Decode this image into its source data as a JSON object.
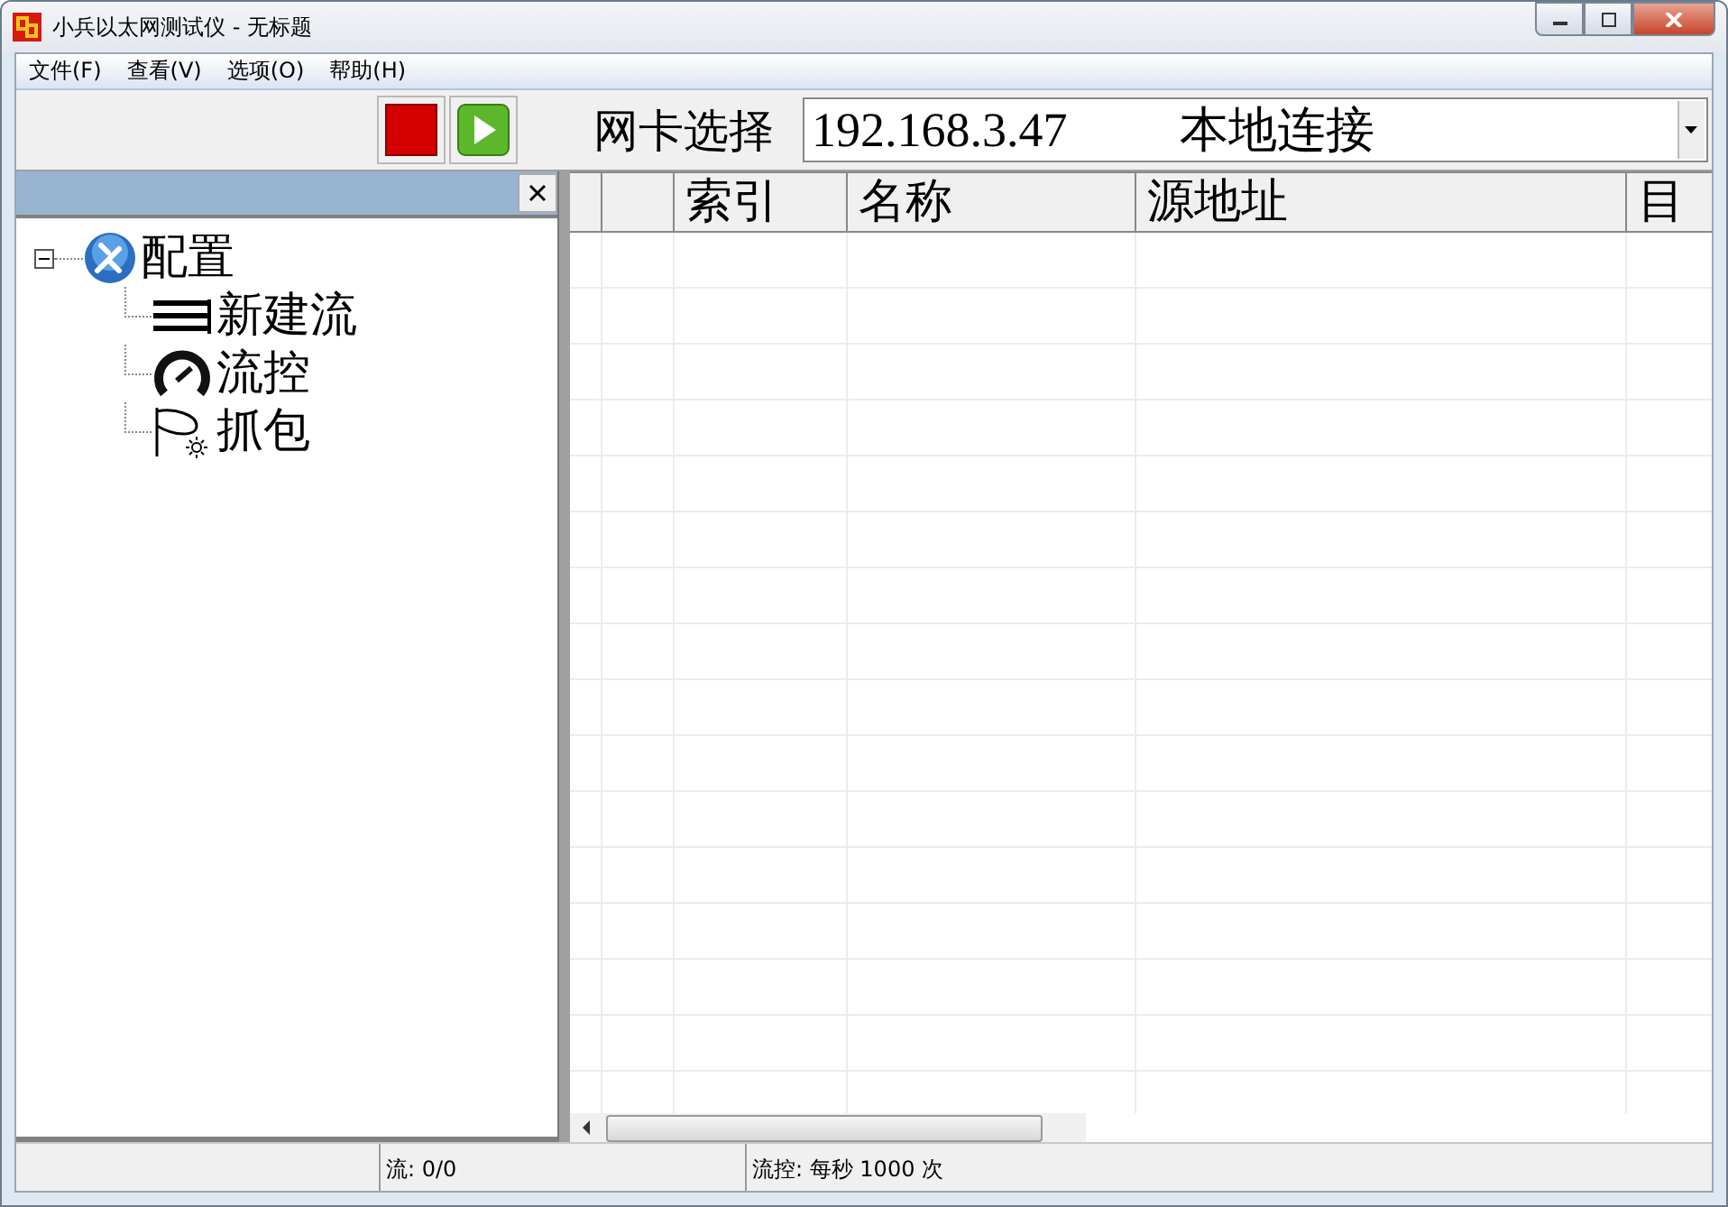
{
  "window": {
    "title": "小兵以太网测试仪 - 无标题"
  },
  "menu": [
    "文件(F)",
    "查看(V)",
    "选项(O)",
    "帮助(H)"
  ],
  "toolbar": {
    "adapter_label": "网卡选择",
    "adapter_ip": "192.168.3.47",
    "adapter_name": "本地连接"
  },
  "tree": [
    {
      "label": "配置",
      "kind": "config",
      "expanded": true,
      "children": [
        {
          "label": "新建流",
          "kind": "stream"
        },
        {
          "label": "流控",
          "kind": "gauge"
        },
        {
          "label": "抓包",
          "kind": "capture"
        }
      ]
    }
  ],
  "table": {
    "columns": [
      "索引",
      "名称",
      "源地址",
      "目"
    ]
  },
  "status_bar": {
    "flows": "流: 0/0",
    "rate": "流控: 每秒 1000 次"
  }
}
